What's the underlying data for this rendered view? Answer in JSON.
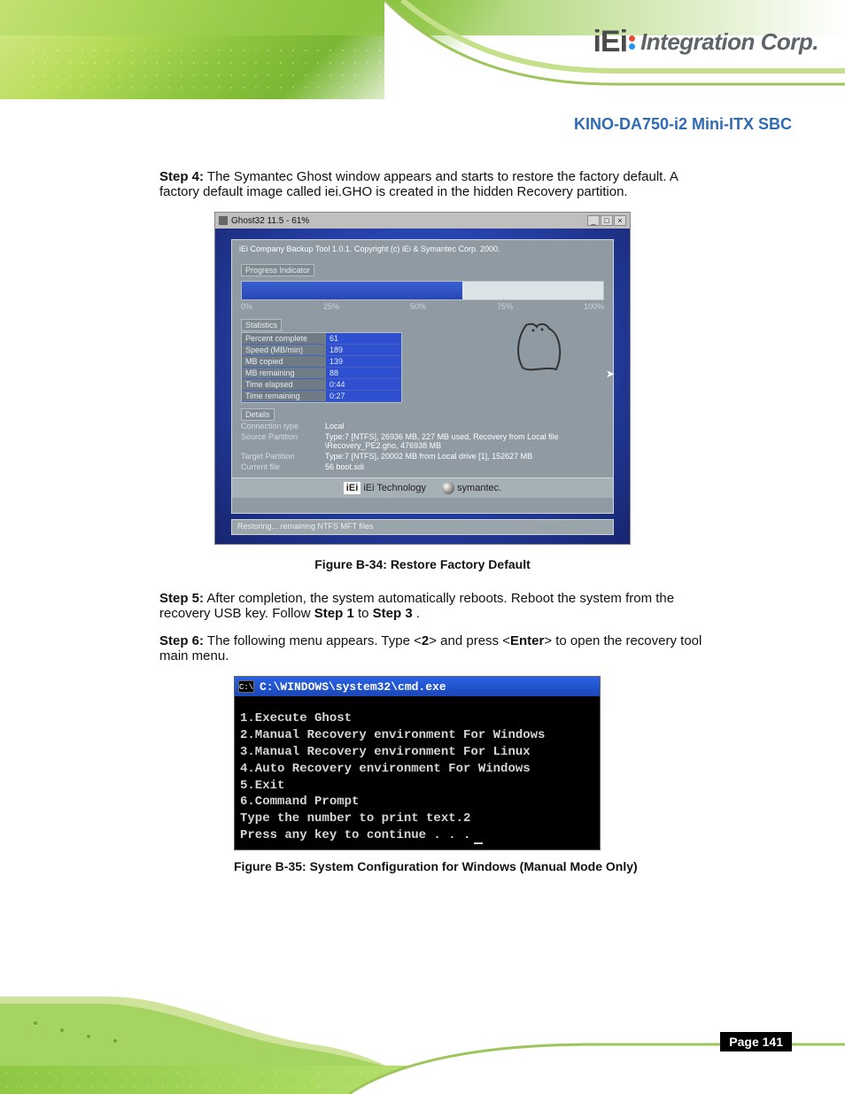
{
  "header": {
    "logo_prefix": "iEi",
    "logo_text": "Integration Corp."
  },
  "product_title": "KINO-DA750-i2 Mini-ITX SBC",
  "steps": {
    "step4": {
      "label": "Step 4:",
      "text": "The Symantec Ghost window appears and starts to restore the factory default. A factory default image called iei.GHO is created in the hidden Recovery partition."
    },
    "step5": {
      "label": "Step 5:",
      "text_a": "After completion, the system automatically reboots. Reboot the system from the recovery USB key. Follow ",
      "text_b": " to ",
      "text_c": ".",
      "ref_step1": "Step 1",
      "ref_step3": "Step 3"
    },
    "step6": {
      "label": "Step 6:",
      "text_a": "The following menu appears. Type <",
      "kbd": "2",
      "text_b": "> and press <",
      "kbd2": "Enter",
      "text_c": "> to open the recovery tool main menu."
    }
  },
  "ghost": {
    "window_title": "Ghost32 11.5 - 61%",
    "copyright": "iEi Company Backup Tool 1.0.1.   Copyright (c) iEi & Symantec Corp. 2000.",
    "progress_label": "Progress Indicator",
    "progress_percent": 61,
    "ticks": [
      "0%",
      "25%",
      "50%",
      "75%",
      "100%"
    ],
    "stats_label": "Statistics",
    "stats": [
      {
        "k": "Percent complete",
        "v": "61"
      },
      {
        "k": "Speed (MB/min)",
        "v": "189"
      },
      {
        "k": "MB copied",
        "v": "139"
      },
      {
        "k": "MB remaining",
        "v": "88"
      },
      {
        "k": "Time elapsed",
        "v": "0:44"
      },
      {
        "k": "Time remaining",
        "v": "0:27"
      }
    ],
    "details_label": "Details",
    "details": [
      {
        "k": "Connection type",
        "v": "Local"
      },
      {
        "k": "Source Partition",
        "v": "Type:7 [NTFS], 26936 MB, 227 MB used, Recovery from Local file \\Recovery_PE2.gho, 476938 MB"
      },
      {
        "k": "Target Partition",
        "v": "Type:7 [NTFS], 20002 MB from Local drive [1], 152627 MB"
      },
      {
        "k": "Current file",
        "v": "56 boot.sdi"
      }
    ],
    "brand_iei": "iEi Technology",
    "brand_sym": "symantec.",
    "status": "Restoring... remaining NTFS MFT files"
  },
  "figure_caption_ghost": "Figure B-34: Restore Factory Default",
  "cmd": {
    "title": "C:\\WINDOWS\\system32\\cmd.exe",
    "icon_text": "C:\\",
    "lines": [
      "1.Execute Ghost",
      "2.Manual Recovery environment For Windows",
      "3.Manual Recovery environment For Linux",
      "4.Auto Recovery environment For Windows",
      "5.Exit",
      "6.Command Prompt",
      "Type the number to print text.2",
      "Press any key to continue . . ."
    ]
  },
  "figure_caption_cmd": "Figure B-35: System Configuration for Windows (Manual Mode Only)",
  "page_number": "Page 141"
}
